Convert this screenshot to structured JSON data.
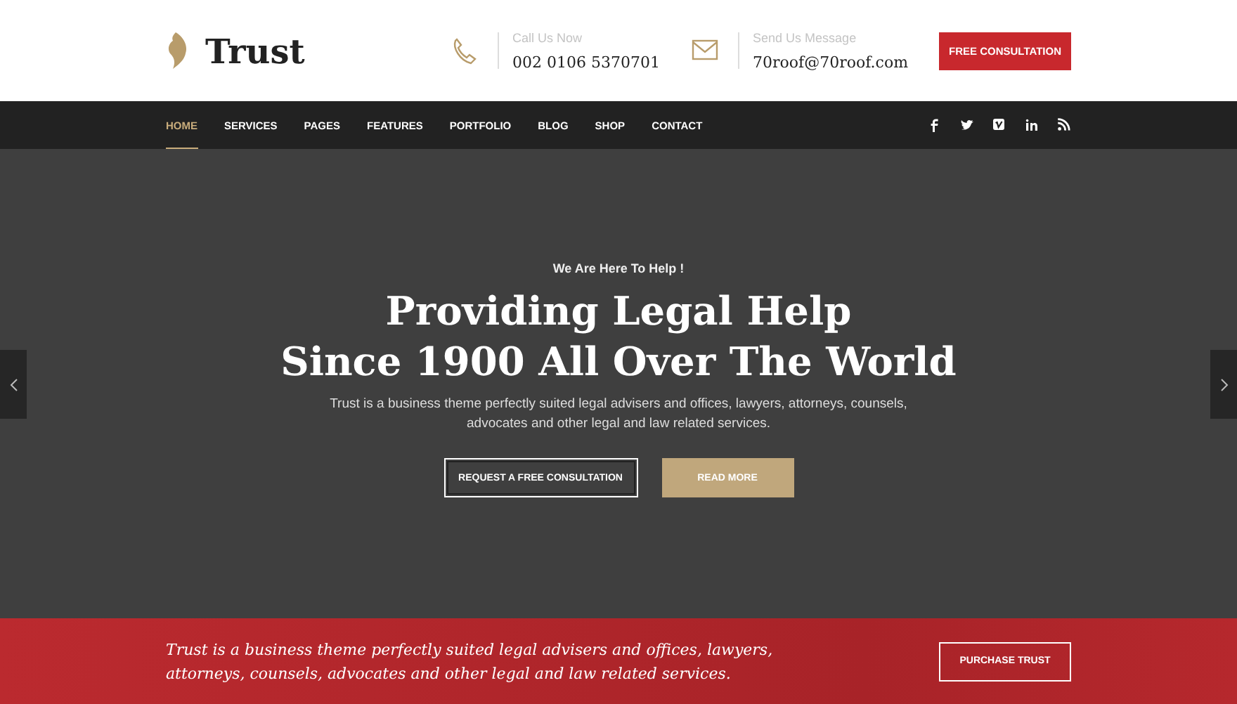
{
  "header": {
    "logo": "Trust",
    "contacts": [
      {
        "kind": "phone",
        "label": "Call Us Now",
        "value": "002 0106 5370701"
      },
      {
        "kind": "mail",
        "label": "Send Us Message",
        "value": "70roof@70roof.com"
      }
    ],
    "button": "FREE CONSULTATION"
  },
  "nav": {
    "items": [
      {
        "label": "HOME",
        "selected": true
      },
      {
        "label": "SERVICES",
        "selected": false
      },
      {
        "label": "PAGES",
        "selected": false
      },
      {
        "label": "FEATURES",
        "selected": false
      },
      {
        "label": "PORTFOLIO",
        "selected": false
      },
      {
        "label": "BLOG",
        "selected": false
      },
      {
        "label": "SHOP",
        "selected": false
      },
      {
        "label": "CONTACT",
        "selected": false
      }
    ],
    "social": [
      {
        "kind": "facebook"
      },
      {
        "kind": "twitter"
      },
      {
        "kind": "vimeo"
      },
      {
        "kind": "linkedin"
      },
      {
        "kind": "rss"
      }
    ]
  },
  "hero": {
    "kicker": "We Are Here To Help !",
    "title_lines": [
      "Providing Legal Help",
      "Since 1900 All Over The World"
    ],
    "text": "Trust is a business theme perfectly suited legal advisers and offices, lawyers, attorneys, counsels, advocates and other legal and law related services.",
    "buttons": [
      {
        "kind": "outline",
        "label": "REQUEST A FREE CONSULTATION"
      },
      {
        "kind": "filled",
        "label": "READ MORE"
      }
    ]
  },
  "cta": {
    "text": "Trust is a business theme perfectly suited legal advisers and offices, lawyers, attorneys, counsels, advocates and other legal and law related services.",
    "button": "PURCHASE TRUST"
  }
}
